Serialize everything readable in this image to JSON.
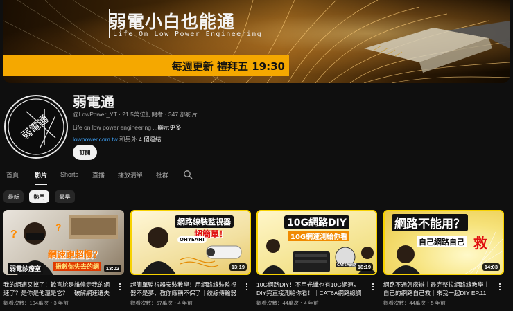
{
  "banner": {
    "title": "弱電小白也能通",
    "subtitle": "Life On Low Power Engineering",
    "schedule": "每週更新 禮拜五 19:30"
  },
  "channel": {
    "avatar_text": "弱電通",
    "name": "弱電通",
    "handle": "@LowPower_YT",
    "meta": "@LowPower_YT · 21.5萬位訂閱者 · 347 部影片",
    "description": "Life on low power engineering ...",
    "description_more": "顯示更多",
    "link": "lowpower.com.tw",
    "link_suffix": " 和另外 ",
    "link_count": "4 個連結",
    "subscribe_label": "訂閱"
  },
  "tabs": [
    {
      "label": "首頁"
    },
    {
      "label": "影片"
    },
    {
      "label": "Shorts"
    },
    {
      "label": "直播"
    },
    {
      "label": "播放清單"
    },
    {
      "label": "社群"
    }
  ],
  "active_tab": "影片",
  "chips": [
    {
      "label": "最新"
    },
    {
      "label": "熱門"
    },
    {
      "label": "最早"
    }
  ],
  "videos": [
    {
      "title": "我的網速又掉了！歡喜尬是誰偷走我的網速了？是你是他還是它？｜破解網速遺失的秘...",
      "meta": "觀看次數：104萬次・3 年前",
      "duration": "13:02",
      "thumb_lines": [
        "網速跑超慢？",
        "揪數你失去的網",
        "弱電診療室"
      ]
    },
    {
      "title": "超簡單監視器安裝教學！用網路線裝監視器不是夢，教你廠稱不保了｜絞線傳輸器接續｜...",
      "meta": "觀看次數：57萬次・4 年前",
      "duration": "13:19",
      "thumb_lines": [
        "網路線裝監視器",
        "超簡單！",
        "OHYEAH!"
      ]
    },
    {
      "title": "10G網路DIY！不用光纖也有10G網速，DIY完直接測給你看！｜CAT6A網路線調+10G網...",
      "meta": "觀看次數：44萬次・4 年前",
      "duration": "18:19",
      "thumb_lines": [
        "10G網路DIY",
        "10G網速測給你看",
        "CAT6A網路線教學"
      ]
    },
    {
      "title": "網路不通怎麼辦｜最完整拉網路線教學｜自己的網路自己救｜來我一起DIY EP.11【弱電...",
      "meta": "觀看次數：44萬次・5 年前",
      "duration": "14:03",
      "thumb_lines": [
        "網路不能用？",
        "自己網路自己",
        "救"
      ]
    }
  ]
}
